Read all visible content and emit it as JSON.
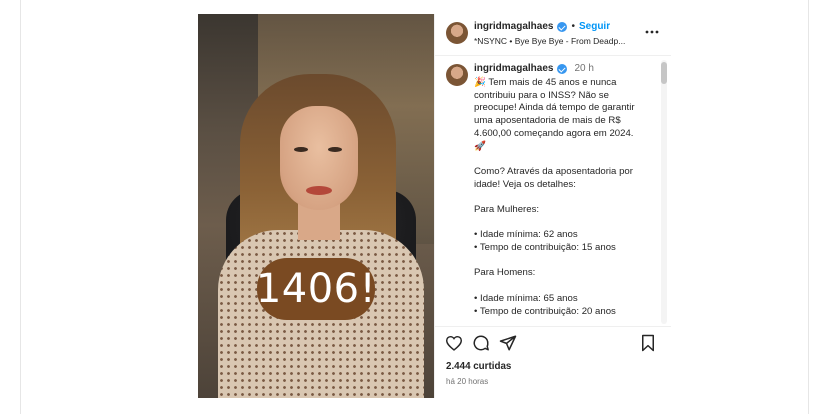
{
  "post": {
    "username": "ingridmagalhaes",
    "follow_label": "Seguir",
    "separator": "•",
    "audio": "*NSYNC • Bye Bye Bye - From Deadp...",
    "more_label": "•••",
    "overlay_text": "1406!",
    "caption": {
      "time": "20 h",
      "lines": [
        "🎉 Tem mais de 45 anos e nunca\ncontribuiu para o INSS? Não se\npreocupe! Ainda dá tempo de garantir\numa aposentadoria de mais de R$\n4.600,00 começando agora em 2024.\n🚀",
        "Como? Através da aposentadoria por\nidade! Veja os detalhes:",
        "Para Mulheres:",
        "• Idade mínima: 62 anos\n• Tempo de contribuição: 15 anos",
        "Para Homens:",
        "• Idade mínima: 65 anos\n• Tempo de contribuição: 20 anos"
      ]
    },
    "likes": "2.444 curtidas",
    "posted": "há 20 horas"
  },
  "icons": {
    "verified": "verified-badge-icon",
    "like": "heart-icon",
    "comment": "comment-icon",
    "share": "send-icon",
    "save": "bookmark-icon",
    "more": "more-options-icon"
  },
  "colors": {
    "accent": "#0095f6",
    "verified": "#3797f0",
    "badge": "#7a4a22",
    "text": "#262626",
    "muted": "#737373"
  }
}
